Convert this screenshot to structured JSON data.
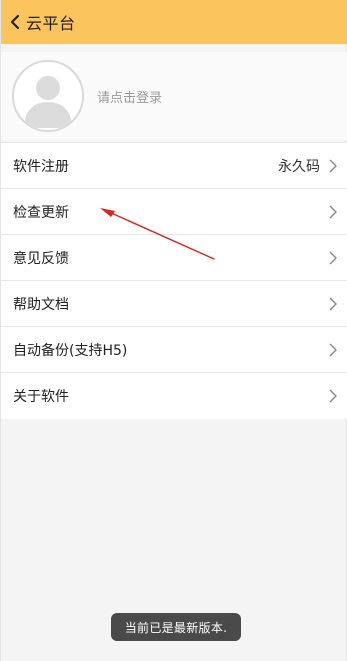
{
  "header": {
    "title": "云平台",
    "back_icon": "chevron-left-icon"
  },
  "profile": {
    "login_prompt": "请点击登录",
    "avatar_icon": "user-avatar-icon"
  },
  "menu": {
    "items": [
      {
        "label": "软件注册",
        "value": "永久码"
      },
      {
        "label": "检查更新",
        "value": ""
      },
      {
        "label": "意见反馈",
        "value": ""
      },
      {
        "label": "帮助文档",
        "value": ""
      },
      {
        "label": "自动备份(支持H5)",
        "value": ""
      },
      {
        "label": "关于软件",
        "value": ""
      }
    ],
    "chevron_icon": "chevron-right-icon"
  },
  "toast": {
    "message": "当前已是最新版本."
  },
  "colors": {
    "header_bg": "#fcc45c",
    "annotation_arrow": "#d9261c",
    "toast_bg": "#4a4a4a"
  }
}
